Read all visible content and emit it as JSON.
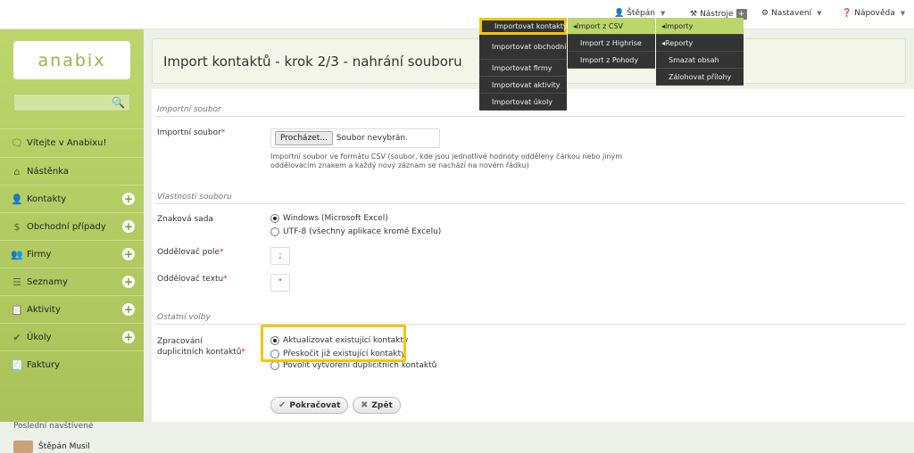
{
  "topbar": {
    "user": "Štěpán",
    "tools": "Nástroje",
    "tools_badge": "+",
    "settings": "Nastavení",
    "help": "Nápověda"
  },
  "sidebar": {
    "logo": "anabix",
    "items": [
      {
        "label": "Vítejte v Anabixu!",
        "icon": "chat-icon",
        "plus": false
      },
      {
        "label": "Nástěnka",
        "icon": "home-icon",
        "plus": false
      },
      {
        "label": "Kontakty",
        "icon": "user-icon",
        "plus": true
      },
      {
        "label": "Obchodní případy",
        "icon": "dollar-icon",
        "plus": true
      },
      {
        "label": "Firmy",
        "icon": "group-icon",
        "plus": true
      },
      {
        "label": "Seznamy",
        "icon": "list-icon",
        "plus": true
      },
      {
        "label": "Aktivity",
        "icon": "clipboard-icon",
        "plus": true
      },
      {
        "label": "Úkoly",
        "icon": "checklist-icon",
        "plus": true
      },
      {
        "label": "Faktury",
        "icon": "invoice-icon",
        "plus": false
      }
    ],
    "recent_label": "Poslední navštívené",
    "recent_user": "Štěpán Musil"
  },
  "page": {
    "title": "Import kontaktů - krok 2/3 - nahrání souboru"
  },
  "form": {
    "sec_file": "Importní soubor",
    "file_label": "Importní soubor",
    "file_button": "Procházet...",
    "file_none": "Soubor nevybrán.",
    "file_hint": "Importní soubor ve formátu CSV (soubor, kde jsou jednotlivé hodnoty odděleny čárkou nebo jiným oddělovacím znakem a každý nový záznam se nachází na novém řádku)",
    "sec_props": "Vlastnosti souboru",
    "charset_label": "Znaková sada",
    "charset_opt1": "Windows (Microsoft Excel)",
    "charset_opt2": "UTF-8 (všechny aplikace kromě Excelu)",
    "field_sep_label": "Oddělovač pole",
    "field_sep_value": ";",
    "text_sep_label": "Oddělovač textu",
    "text_sep_value": "\"",
    "sec_other": "Ostatní volby",
    "dup_label_1": "Zpracování",
    "dup_label_2": "duplicitních kontaktů",
    "dup_opt1": "Aktualizovat existující kontakty",
    "dup_opt2": "Přeskočit již existující kontakty",
    "dup_opt3": "Povolit vytvoření duplicitních kontaktů",
    "continue": "Pokračovat",
    "back": "Zpět"
  },
  "menus": {
    "col1": [
      "Importovat kontakty",
      "Importovat obchodní případy",
      "Importovat firmy",
      "Importovat aktivity",
      "Importovat úkoly"
    ],
    "col2": [
      "Import z CSV",
      "Import z Highrise",
      "Import z Pohody"
    ],
    "col3": [
      "Importy",
      "Reporty",
      "Smazat obsah",
      "Zálohovat přílohy"
    ]
  }
}
